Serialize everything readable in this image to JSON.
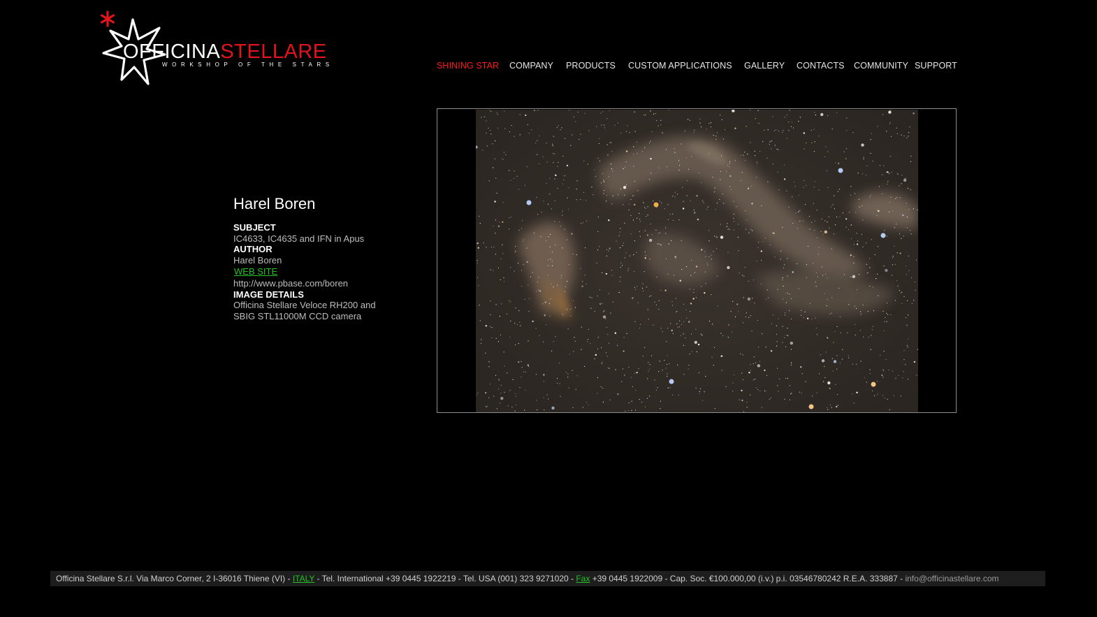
{
  "logo": {
    "word_white": "OFFICINA",
    "word_red": "STELLARE",
    "tagline": "WORKSHOP OF THE STARS",
    "colors": {
      "white": "#ffffff",
      "red": "#e0141c"
    }
  },
  "nav": {
    "items": [
      {
        "label": "SHINING STAR",
        "active": true
      },
      {
        "label": "COMPANY",
        "active": false
      },
      {
        "label": "PRODUCTS",
        "active": false
      },
      {
        "label": "CUSTOM APPLICATIONS",
        "active": false
      },
      {
        "label": "GALLERY",
        "active": false
      },
      {
        "label": "CONTACTS",
        "active": false
      },
      {
        "label": "COMMUNITY",
        "active": false
      },
      {
        "label": "SUPPORT",
        "active": false
      }
    ],
    "active_color": "#ff1a1a"
  },
  "details": {
    "title": "Harel Boren",
    "subject_label": "SUBJECT",
    "subject_value": "IC4633, IC4635 and IFN in Apus",
    "author_label": "AUTHOR",
    "author_value": "Harel Boren",
    "website_link": "WEB SITE",
    "website_url": "http://www.pbase.com/boren",
    "image_details_label": "IMAGE DETAILS",
    "image_details_line1": "Officina Stellare Veloce RH200 and",
    "image_details_line2": "SBIG STL11000M CCD camera"
  },
  "image": {
    "description_icon": "astrophoto-nebula"
  },
  "footer": {
    "part1": "Officina Stellare S.r.l. Via Marco Corner, 2 I-36016 Thiene (VI) - ",
    "italy_link": "ITALY",
    "part2": " - Tel. International +39 0445 1922219 - Tel. USA (001) 323 9271020 - ",
    "fax_link": "Fax",
    "part3": " +39 0445 1922009 - Cap. Soc. €100.000,00 (i.v.) p.i. 03546780242 R.E.A. 333887 - ",
    "email": "info@officinastellare.com",
    "link_color": "#22c322"
  }
}
